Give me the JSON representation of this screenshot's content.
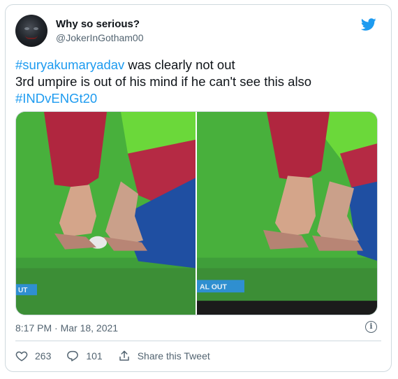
{
  "tweet": {
    "author": {
      "display_name": "Why so serious?",
      "handle": "@JokerInGotham00"
    },
    "text": {
      "line1_hashtag": "#suryakumaryadav",
      "line1_rest": " was clearly not out",
      "line2": "3rd umpire is out of his mind if he can't see this also",
      "line3_hashtag": "#INDvENGt20"
    },
    "media": {
      "left_overlay_text": "UT",
      "right_overlay_text": "AL OUT"
    },
    "timestamp": "8:17 PM · Mar 18, 2021",
    "actions": {
      "likes": "263",
      "replies": "101",
      "share_label": "Share this Tweet"
    }
  },
  "icons": {
    "brand": "twitter-bird-icon",
    "info": "info-icon",
    "like": "heart-icon",
    "reply": "reply-icon",
    "share": "share-icon"
  },
  "colors": {
    "accent": "#1d9bf0",
    "text": "#0f1419",
    "secondary": "#536471",
    "border": "#cfd9de"
  }
}
